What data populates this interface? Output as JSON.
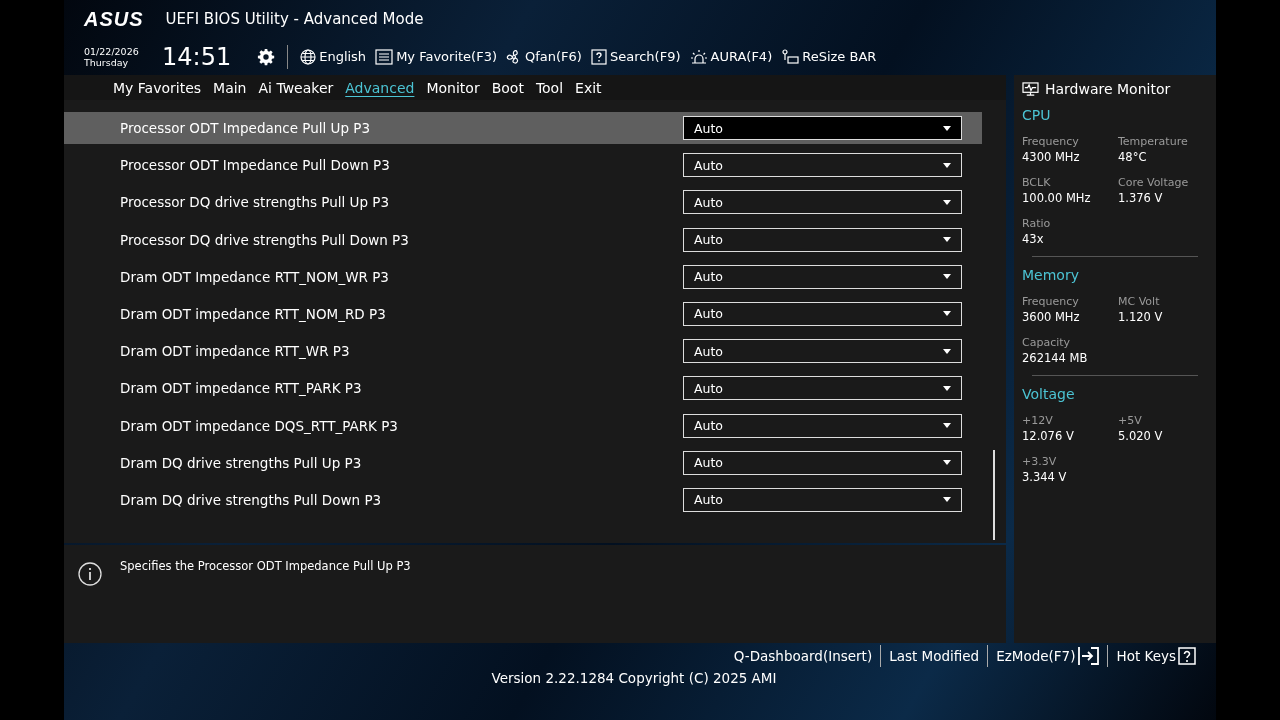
{
  "header": {
    "logo": "ASUS",
    "title": "UEFI BIOS Utility - Advanced Mode",
    "date": "01/22/2026",
    "day": "Thursday",
    "time": "14:51",
    "tools": [
      {
        "kind": "globe",
        "label": "English"
      },
      {
        "kind": "favorite",
        "label": "My Favorite(F3)"
      },
      {
        "kind": "fan",
        "label": "Qfan(F6)"
      },
      {
        "kind": "search",
        "label": "Search(F9)"
      },
      {
        "kind": "aura",
        "label": "AURA(F4)"
      },
      {
        "kind": "resize",
        "label": "ReSize BAR"
      }
    ]
  },
  "tabs": [
    {
      "label": "My Favorites",
      "selected": false
    },
    {
      "label": "Main",
      "selected": false
    },
    {
      "label": "Ai Tweaker",
      "selected": false
    },
    {
      "label": "Advanced",
      "selected": true
    },
    {
      "label": "Monitor",
      "selected": false
    },
    {
      "label": "Boot",
      "selected": false
    },
    {
      "label": "Tool",
      "selected": false
    },
    {
      "label": "Exit",
      "selected": false
    }
  ],
  "settings": [
    {
      "label": "Processor ODT Impedance Pull Up P3",
      "value": "Auto",
      "selected": true
    },
    {
      "label": "Processor ODT Impedance Pull Down P3",
      "value": "Auto",
      "selected": false
    },
    {
      "label": "Processor DQ drive strengths Pull Up P3",
      "value": "Auto",
      "selected": false
    },
    {
      "label": "Processor DQ drive strengths Pull Down P3",
      "value": "Auto",
      "selected": false
    },
    {
      "label": "Dram ODT Impedance RTT_NOM_WR P3",
      "value": "Auto",
      "selected": false
    },
    {
      "label": "Dram ODT impedance RTT_NOM_RD P3",
      "value": "Auto",
      "selected": false
    },
    {
      "label": "Dram ODT impedance RTT_WR P3",
      "value": "Auto",
      "selected": false
    },
    {
      "label": "Dram ODT impedance RTT_PARK P3",
      "value": "Auto",
      "selected": false
    },
    {
      "label": "Dram ODT impedance DQS_RTT_PARK P3",
      "value": "Auto",
      "selected": false
    },
    {
      "label": "Dram DQ drive strengths Pull Up P3",
      "value": "Auto",
      "selected": false
    },
    {
      "label": "Dram DQ drive strengths Pull Down P3",
      "value": "Auto",
      "selected": false
    }
  ],
  "help": {
    "text": "Specifies the Processor ODT Impedance Pull Up P3"
  },
  "hardware_monitor": {
    "title": "Hardware Monitor",
    "sections": [
      {
        "title": "CPU",
        "items": [
          {
            "label": "Frequency",
            "value": "4300 MHz"
          },
          {
            "label": "Temperature",
            "value": "48°C"
          },
          {
            "label": "BCLK",
            "value": "100.00 MHz"
          },
          {
            "label": "Core Voltage",
            "value": "1.376 V"
          },
          {
            "label": "Ratio",
            "value": "43x"
          }
        ]
      },
      {
        "title": "Memory",
        "items": [
          {
            "label": "Frequency",
            "value": "3600 MHz"
          },
          {
            "label": "MC Volt",
            "value": "1.120 V"
          },
          {
            "label": "Capacity",
            "value": "262144 MB"
          }
        ]
      },
      {
        "title": "Voltage",
        "items": [
          {
            "label": "+12V",
            "value": "12.076 V"
          },
          {
            "label": "+5V",
            "value": "5.020 V"
          },
          {
            "label": "+3.3V",
            "value": "3.344 V"
          }
        ]
      }
    ]
  },
  "footer": {
    "links": [
      {
        "kind": "plain",
        "label": "Q-Dashboard(Insert)"
      },
      {
        "kind": "plain",
        "label": "Last Modified"
      },
      {
        "kind": "exit",
        "label": "EzMode(F7)"
      },
      {
        "kind": "help",
        "label": "Hot Keys"
      }
    ],
    "version": "Version 2.22.1284 Copyright (C) 2025 AMI"
  }
}
